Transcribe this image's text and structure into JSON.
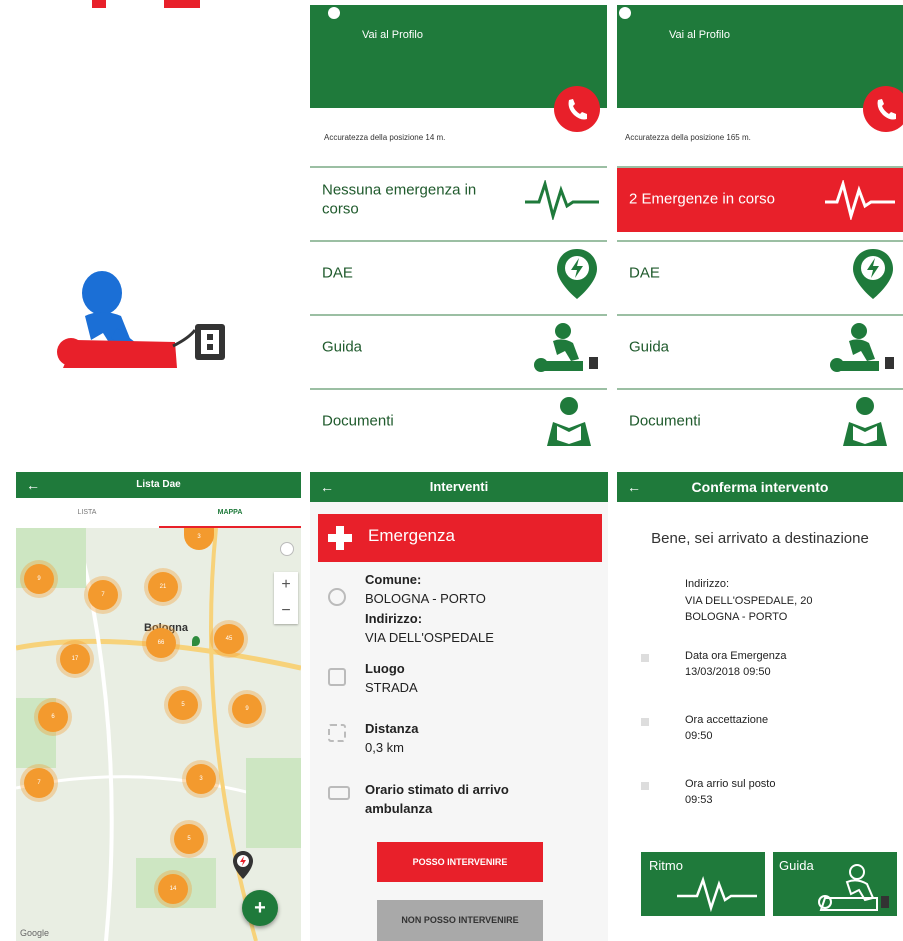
{
  "panels": {
    "home1": {
      "profile_link": "Vai al Profilo",
      "accuracy": "Accuratezza della posizione 14 m.",
      "rows": [
        {
          "label": "Nessuna emergenza in corso"
        },
        {
          "label": "DAE"
        },
        {
          "label": "Guida"
        },
        {
          "label": "Documenti"
        }
      ]
    },
    "home2": {
      "profile_link": "Vai al Profilo",
      "accuracy": "Accuratezza della posizione 165 m.",
      "rows": [
        {
          "label": "2 Emergenze in corso"
        },
        {
          "label": "DAE"
        },
        {
          "label": "Guida"
        },
        {
          "label": "Documenti"
        }
      ]
    },
    "map": {
      "title": "Lista Dae",
      "back": "←",
      "tabs": [
        "LISTA",
        "MAPPA"
      ],
      "city_label": "Bologna",
      "clusters": [
        "9",
        "7",
        "21",
        "66",
        "45",
        "17",
        "6",
        "5",
        "9",
        "7",
        "3",
        "5",
        "3",
        "14"
      ],
      "zoom_in": "+",
      "zoom_out": "−",
      "add": "+",
      "google": "Google"
    },
    "interventi": {
      "title": "Interventi",
      "back": "←",
      "banner": "Emergenza",
      "comune_label": "Comune:",
      "comune_value": "BOLOGNA - PORTO",
      "indirizzo_label": "Indirizzo:",
      "indirizzo_value": "VIA DELL'OSPEDALE",
      "luogo_label": "Luogo",
      "luogo_value": "STRADA",
      "distanza_label": "Distanza",
      "distanza_value": "0,3 km",
      "orario_label": "Orario stimato di arrivo ambulanza",
      "btn_yes": "POSSO INTERVENIRE",
      "btn_no": "NON POSSO INTERVENIRE"
    },
    "conferma": {
      "title": "Conferma intervento",
      "back": "←",
      "heading": "Bene, sei arrivato a destinazione",
      "indirizzo_label": "Indirizzo:",
      "indirizzo_line1": "VIA DELL'OSPEDALE, 20",
      "indirizzo_line2": "BOLOGNA - PORTO",
      "data_label": "Data ora Emergenza",
      "data_value": "13/03/2018 09:50",
      "accettazione_label": "Ora accettazione",
      "accettazione_value": "09:50",
      "arrivo_label": "Ora arrio sul posto",
      "arrivo_value": "09:53",
      "btn_ritmo": "Ritmo",
      "btn_guida": "Guida"
    }
  },
  "colors": {
    "green": "#1f7a3b",
    "red": "#e8202a",
    "orange": "#f39a2e",
    "blue": "#1b6fd6"
  }
}
